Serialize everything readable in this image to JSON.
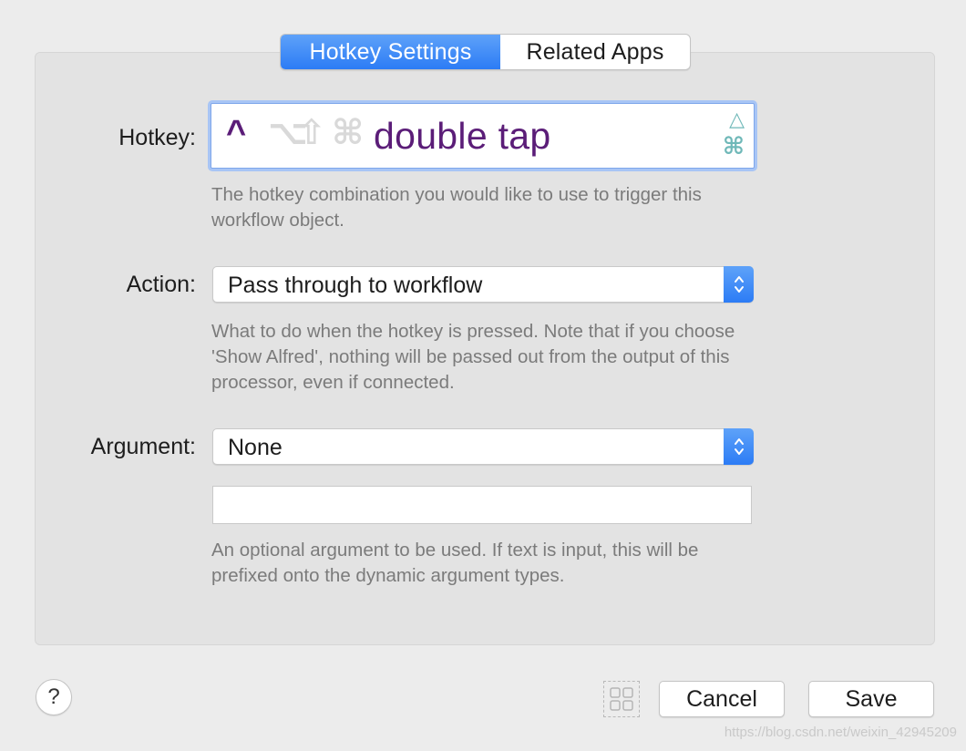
{
  "tabs": {
    "active": "Hotkey Settings",
    "inactive": "Related Apps"
  },
  "hotkey": {
    "label": "Hotkey:",
    "modifiers": [
      "^",
      "⌥",
      "⇧",
      "⌘"
    ],
    "modifiers_active": [
      "^"
    ],
    "value": "double tap",
    "side_icons": [
      "△",
      "⌘"
    ],
    "help": "The hotkey combination you would like to use to trigger this workflow object."
  },
  "action": {
    "label": "Action:",
    "selected": "Pass through to workflow",
    "help": "What to do when the hotkey is pressed. Note that if you choose 'Show Alfred', nothing will be passed out from the output of this processor, even if connected."
  },
  "argument": {
    "label": "Argument:",
    "selected": "None",
    "input_value": "",
    "help": "An optional argument to be used. If text is input, this will be prefixed onto the dynamic argument types."
  },
  "footer": {
    "help_label": "?",
    "cancel_label": "Cancel",
    "save_label": "Save",
    "watermark": "https://blog.csdn.net/weixin_42945209"
  },
  "colors": {
    "accent": "#2c7cf5",
    "hotkey_text": "#5b1d78",
    "help_text": "#7b7b7b"
  }
}
